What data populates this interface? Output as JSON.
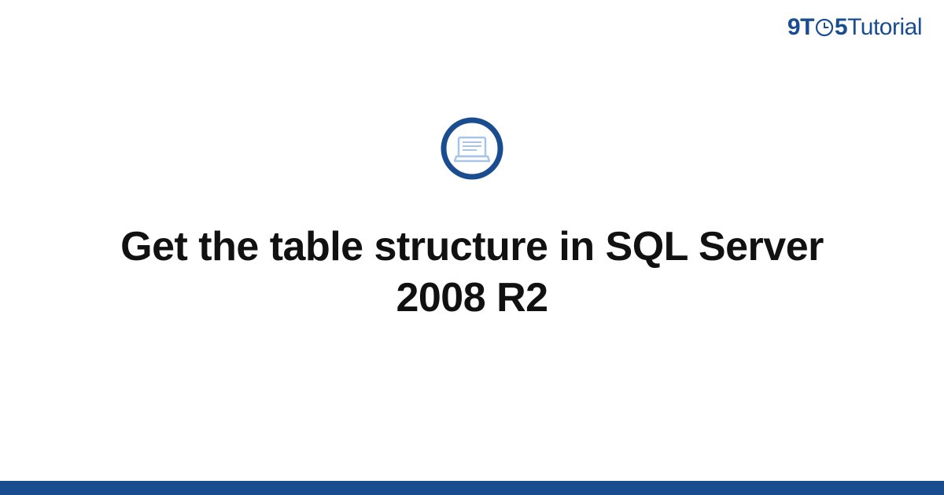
{
  "brand": {
    "part1": "9",
    "part2": "T",
    "part3": "5",
    "part4": "Tutorial"
  },
  "page": {
    "title": "Get the table structure in SQL Server 2008 R2"
  },
  "colors": {
    "brand": "#1a4d8f",
    "icon_light": "#a8c5e8",
    "text": "#111111"
  }
}
